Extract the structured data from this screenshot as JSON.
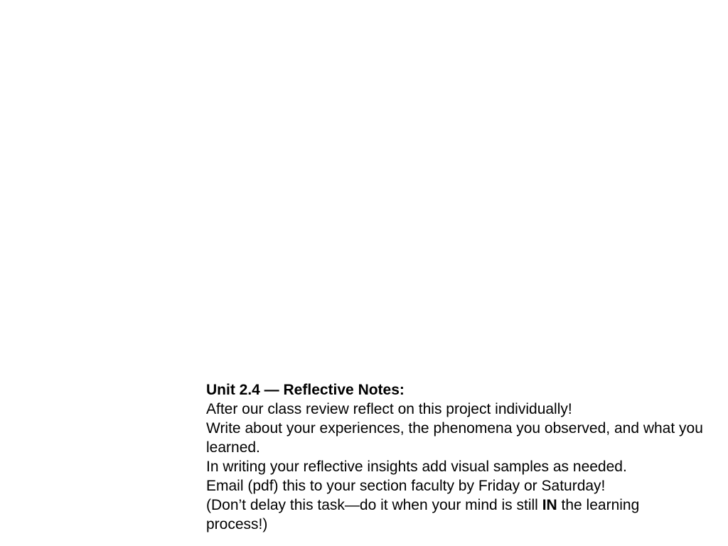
{
  "note": {
    "title": "Unit 2.4 — Reflective Notes:",
    "line1": "After our class review reflect on this project individually!",
    "line2": "Write about your experiences, the phenomena you observed, and what you learned.",
    "line3": "In writing your reflective insights add visual samples as needed.",
    "line4": "Email (pdf) this to your section faculty by Friday or Saturday!",
    "line5_pre": "(Don’t delay this task—do it when your mind is still ",
    "line5_em": "IN",
    "line5_post": " the learning process!)"
  }
}
